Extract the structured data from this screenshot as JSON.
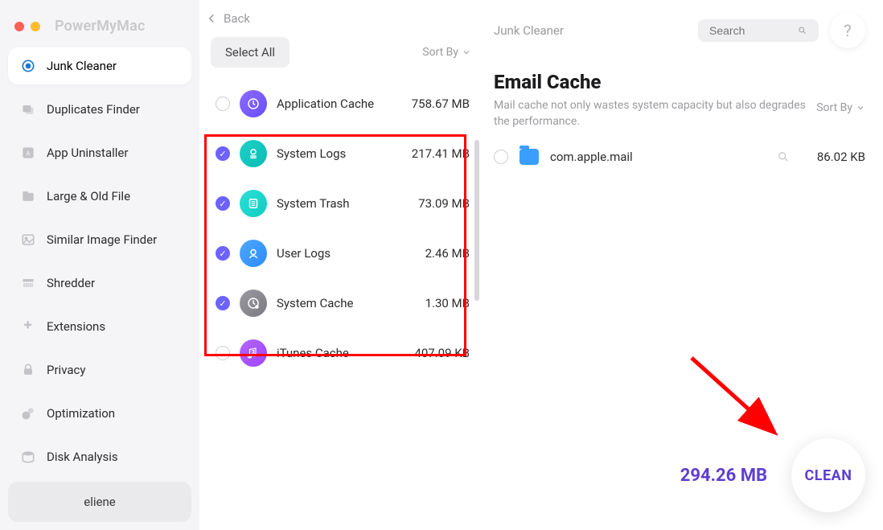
{
  "app": {
    "title": "PowerMyMac"
  },
  "nav": {
    "items": [
      {
        "label": "Junk Cleaner",
        "icon": "junk-cleaner-icon"
      },
      {
        "label": "Duplicates Finder",
        "icon": "duplicates-icon"
      },
      {
        "label": "App Uninstaller",
        "icon": "uninstaller-icon"
      },
      {
        "label": "Large & Old File",
        "icon": "large-file-icon"
      },
      {
        "label": "Similar Image Finder",
        "icon": "similar-image-icon"
      },
      {
        "label": "Shredder",
        "icon": "shredder-icon"
      },
      {
        "label": "Extensions",
        "icon": "extensions-icon"
      },
      {
        "label": "Privacy",
        "icon": "privacy-icon"
      },
      {
        "label": "Optimization",
        "icon": "optimization-icon"
      },
      {
        "label": "Disk Analysis",
        "icon": "disk-icon"
      }
    ]
  },
  "user": {
    "name": "eliene"
  },
  "back": {
    "label": "Back"
  },
  "middle": {
    "select_all": "Select All",
    "sort_by": "Sort By",
    "items": [
      {
        "name": "Application Cache",
        "size": "758.67 MB",
        "checked": false,
        "icon": "app-cache-icon",
        "bg": "bg-purple"
      },
      {
        "name": "System Logs",
        "size": "217.41 MB",
        "checked": true,
        "icon": "system-logs-icon",
        "bg": "bg-teal"
      },
      {
        "name": "System Trash",
        "size": "73.09 MB",
        "checked": true,
        "icon": "system-trash-icon",
        "bg": "bg-teal2"
      },
      {
        "name": "User Logs",
        "size": "2.46 MB",
        "checked": true,
        "icon": "user-logs-icon",
        "bg": "bg-blue"
      },
      {
        "name": "System Cache",
        "size": "1.30 MB",
        "checked": true,
        "icon": "system-cache-icon",
        "bg": "bg-gray"
      },
      {
        "name": "iTunes Cache",
        "size": "407.09 KB",
        "checked": false,
        "icon": "itunes-cache-icon",
        "bg": "bg-violet"
      }
    ]
  },
  "right": {
    "breadcrumb": "Junk Cleaner",
    "search_placeholder": "Search",
    "help": "?",
    "title": "Email Cache",
    "description": "Mail cache not only wastes system capacity but also degrades the performance.",
    "sort_by": "Sort By",
    "files": [
      {
        "name": "com.apple.mail",
        "size": "86.02 KB",
        "checked": false
      }
    ]
  },
  "footer": {
    "total_size": "294.26 MB",
    "clean_label": "CLEAN"
  }
}
